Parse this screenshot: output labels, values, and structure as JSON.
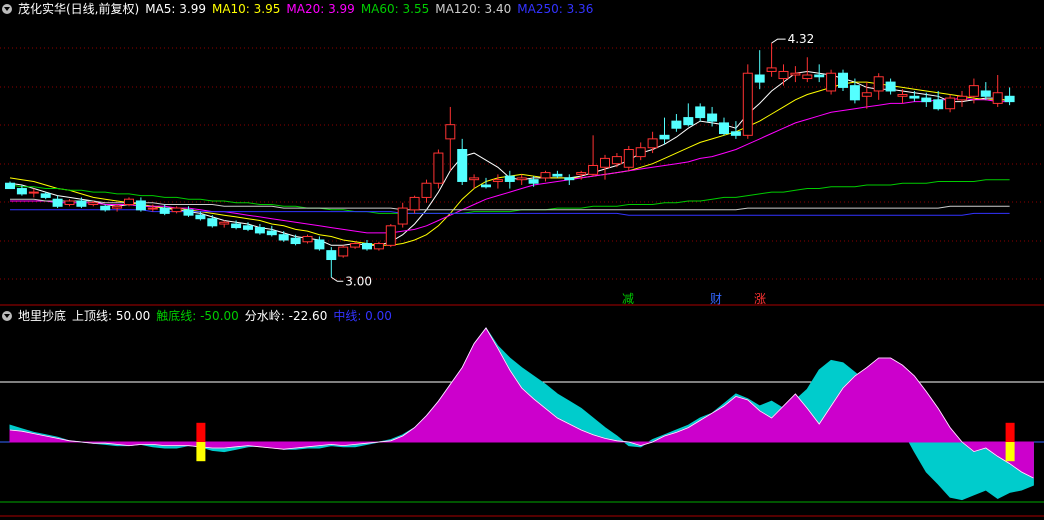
{
  "header": {
    "title": "茂化实华(日线,前复权)",
    "ma_labels": [
      {
        "text": "MA5: 3.99",
        "color": "#ffffff"
      },
      {
        "text": "MA10: 3.95",
        "color": "#ffff00"
      },
      {
        "text": "MA20: 3.99",
        "color": "#ff00ff"
      },
      {
        "text": "MA60: 3.55",
        "color": "#00cc00"
      },
      {
        "text": "MA120: 3.40",
        "color": "#cccccc"
      },
      {
        "text": "MA250: 3.36",
        "color": "#3333ff"
      }
    ]
  },
  "indicator_header": {
    "name": "地里抄底",
    "labels": [
      {
        "text": "上顶线: 50.00",
        "color": "#ffffff"
      },
      {
        "text": "触底线: -50.00",
        "color": "#00cc00"
      },
      {
        "text": "分水岭: -22.60",
        "color": "#ffffff"
      },
      {
        "text": "中线: 0.00",
        "color": "#3333ff"
      }
    ]
  },
  "annotations": {
    "high_label": "4.32",
    "low_label": "3.00",
    "markers": [
      {
        "text": "减",
        "color": "#00cc00"
      },
      {
        "text": "财",
        "color": "#3366ff"
      },
      {
        "text": "涨",
        "color": "#ff3333"
      }
    ]
  },
  "colors": {
    "up": "#ff3333",
    "down": "#54ffff",
    "bg": "#000000",
    "grid": "#8b0000"
  },
  "chart_data": [
    {
      "type": "candlestick",
      "title": "茂化实华(日线,前复权)",
      "ylim": [
        2.9,
        4.45
      ],
      "candles": [
        [
          3.53,
          3.54,
          3.5,
          3.5
        ],
        [
          3.5,
          3.52,
          3.46,
          3.47
        ],
        [
          3.48,
          3.5,
          3.45,
          3.48
        ],
        [
          3.47,
          3.48,
          3.44,
          3.45
        ],
        [
          3.44,
          3.46,
          3.39,
          3.4
        ],
        [
          3.41,
          3.44,
          3.4,
          3.43
        ],
        [
          3.43,
          3.45,
          3.39,
          3.4
        ],
        [
          3.41,
          3.43,
          3.4,
          3.42
        ],
        [
          3.4,
          3.41,
          3.37,
          3.38
        ],
        [
          3.39,
          3.41,
          3.37,
          3.4
        ],
        [
          3.41,
          3.45,
          3.4,
          3.44
        ],
        [
          3.43,
          3.45,
          3.37,
          3.38
        ],
        [
          3.39,
          3.41,
          3.37,
          3.39
        ],
        [
          3.39,
          3.41,
          3.35,
          3.36
        ],
        [
          3.37,
          3.4,
          3.36,
          3.39
        ],
        [
          3.38,
          3.4,
          3.34,
          3.35
        ],
        [
          3.35,
          3.37,
          3.32,
          3.33
        ],
        [
          3.33,
          3.35,
          3.28,
          3.29
        ],
        [
          3.3,
          3.32,
          3.28,
          3.31
        ],
        [
          3.3,
          3.32,
          3.27,
          3.28
        ],
        [
          3.29,
          3.31,
          3.26,
          3.27
        ],
        [
          3.28,
          3.3,
          3.24,
          3.25
        ],
        [
          3.26,
          3.29,
          3.23,
          3.24
        ],
        [
          3.24,
          3.26,
          3.2,
          3.21
        ],
        [
          3.22,
          3.24,
          3.18,
          3.19
        ],
        [
          3.2,
          3.24,
          3.19,
          3.23
        ],
        [
          3.21,
          3.23,
          3.15,
          3.16
        ],
        [
          3.15,
          3.17,
          3.0,
          3.1
        ],
        [
          3.12,
          3.18,
          3.11,
          3.17
        ],
        [
          3.17,
          3.2,
          3.16,
          3.19
        ],
        [
          3.19,
          3.21,
          3.15,
          3.16
        ],
        [
          3.16,
          3.2,
          3.15,
          3.19
        ],
        [
          3.18,
          3.3,
          3.17,
          3.29
        ],
        [
          3.3,
          3.42,
          3.28,
          3.39
        ],
        [
          3.38,
          3.46,
          3.36,
          3.45
        ],
        [
          3.45,
          3.55,
          3.42,
          3.53
        ],
        [
          3.53,
          3.72,
          3.5,
          3.7
        ],
        [
          3.78,
          3.96,
          3.6,
          3.86
        ],
        [
          3.72,
          3.78,
          3.52,
          3.54
        ],
        [
          3.55,
          3.58,
          3.5,
          3.56
        ],
        [
          3.52,
          3.56,
          3.5,
          3.51
        ],
        [
          3.54,
          3.58,
          3.5,
          3.55
        ],
        [
          3.57,
          3.6,
          3.5,
          3.54
        ],
        [
          3.55,
          3.58,
          3.52,
          3.56
        ],
        [
          3.55,
          3.57,
          3.51,
          3.53
        ],
        [
          3.56,
          3.6,
          3.54,
          3.59
        ],
        [
          3.58,
          3.6,
          3.56,
          3.57
        ],
        [
          3.56,
          3.58,
          3.52,
          3.55
        ],
        [
          3.58,
          3.6,
          3.55,
          3.59
        ],
        [
          3.58,
          3.8,
          3.57,
          3.63
        ],
        [
          3.62,
          3.69,
          3.55,
          3.67
        ],
        [
          3.64,
          3.7,
          3.62,
          3.68
        ],
        [
          3.62,
          3.74,
          3.6,
          3.72
        ],
        [
          3.68,
          3.76,
          3.66,
          3.73
        ],
        [
          3.73,
          3.82,
          3.7,
          3.78
        ],
        [
          3.8,
          3.9,
          3.75,
          3.78
        ],
        [
          3.88,
          3.92,
          3.82,
          3.84
        ],
        [
          3.9,
          3.98,
          3.85,
          3.86
        ],
        [
          3.96,
          3.98,
          3.88,
          3.9
        ],
        [
          3.92,
          3.96,
          3.85,
          3.88
        ],
        [
          3.87,
          3.9,
          3.8,
          3.81
        ],
        [
          3.82,
          3.88,
          3.78,
          3.8
        ],
        [
          3.8,
          4.2,
          3.78,
          4.15
        ],
        [
          4.14,
          4.28,
          4.06,
          4.1
        ],
        [
          4.16,
          4.32,
          4.13,
          4.18
        ],
        [
          4.12,
          4.2,
          4.08,
          4.16
        ],
        [
          4.14,
          4.19,
          4.1,
          4.15
        ],
        [
          4.12,
          4.24,
          4.1,
          4.14
        ],
        [
          4.14,
          4.2,
          4.1,
          4.13
        ],
        [
          4.05,
          4.17,
          4.03,
          4.15
        ],
        [
          4.15,
          4.17,
          4.05,
          4.07
        ],
        [
          4.08,
          4.12,
          3.98,
          4.0
        ],
        [
          4.02,
          4.1,
          3.95,
          4.04
        ],
        [
          4.05,
          4.15,
          4.0,
          4.13
        ],
        [
          4.1,
          4.12,
          4.03,
          4.05
        ],
        [
          4.02,
          4.06,
          3.98,
          4.03
        ],
        [
          4.02,
          4.05,
          3.99,
          4.01
        ],
        [
          4.01,
          4.04,
          3.96,
          3.99
        ],
        [
          4.0,
          4.05,
          3.94,
          3.95
        ],
        [
          3.95,
          4.03,
          3.93,
          4.01
        ],
        [
          4.0,
          4.05,
          3.96,
          4.02
        ],
        [
          4.02,
          4.12,
          3.98,
          4.08
        ],
        [
          4.05,
          4.1,
          4.0,
          4.02
        ],
        [
          3.98,
          4.14,
          3.96,
          4.04
        ],
        [
          4.02,
          4.07,
          3.97,
          3.99
        ]
      ],
      "ma": {
        "MA5": [
          3.53,
          3.52,
          3.5,
          3.48,
          3.46,
          3.45,
          3.44,
          3.43,
          3.41,
          3.4,
          3.41,
          3.4,
          3.4,
          3.39,
          3.38,
          3.37,
          3.36,
          3.34,
          3.32,
          3.31,
          3.3,
          3.28,
          3.27,
          3.25,
          3.23,
          3.22,
          3.21,
          3.18,
          3.18,
          3.19,
          3.18,
          3.18,
          3.2,
          3.24,
          3.3,
          3.38,
          3.48,
          3.6,
          3.68,
          3.7,
          3.66,
          3.62,
          3.56,
          3.55,
          3.56,
          3.56,
          3.56,
          3.56,
          3.57,
          3.59,
          3.61,
          3.63,
          3.66,
          3.7,
          3.72,
          3.75,
          3.79,
          3.84,
          3.88,
          3.87,
          3.86,
          3.84,
          3.92,
          3.98,
          4.05,
          4.1,
          4.15,
          4.16,
          4.15,
          4.14,
          4.12,
          4.1,
          4.07,
          4.06,
          4.06,
          4.05,
          4.04,
          4.03,
          4.02,
          3.99,
          3.99,
          4.0,
          4.01,
          4.01,
          3.99
        ],
        "MA10": [
          3.56,
          3.55,
          3.54,
          3.52,
          3.5,
          3.49,
          3.47,
          3.45,
          3.44,
          3.43,
          3.42,
          3.41,
          3.4,
          3.39,
          3.39,
          3.38,
          3.37,
          3.36,
          3.35,
          3.34,
          3.33,
          3.32,
          3.3,
          3.29,
          3.27,
          3.26,
          3.24,
          3.23,
          3.21,
          3.2,
          3.19,
          3.18,
          3.18,
          3.19,
          3.21,
          3.24,
          3.29,
          3.36,
          3.44,
          3.5,
          3.54,
          3.56,
          3.57,
          3.58,
          3.57,
          3.56,
          3.56,
          3.56,
          3.56,
          3.57,
          3.58,
          3.59,
          3.6,
          3.62,
          3.64,
          3.67,
          3.7,
          3.73,
          3.76,
          3.78,
          3.8,
          3.82,
          3.85,
          3.88,
          3.92,
          3.96,
          4.0,
          4.03,
          4.05,
          4.07,
          4.09,
          4.1,
          4.1,
          4.09,
          4.08,
          4.07,
          4.06,
          4.05,
          4.04,
          4.03,
          4.02,
          4.01,
          4.0,
          4.0,
          4.0
        ],
        "MA20": [
          3.43,
          3.43,
          3.43,
          3.43,
          3.42,
          3.42,
          3.42,
          3.42,
          3.41,
          3.41,
          3.41,
          3.4,
          3.4,
          3.4,
          3.39,
          3.39,
          3.38,
          3.37,
          3.37,
          3.36,
          3.35,
          3.34,
          3.33,
          3.32,
          3.31,
          3.3,
          3.29,
          3.28,
          3.27,
          3.26,
          3.25,
          3.25,
          3.25,
          3.26,
          3.27,
          3.29,
          3.32,
          3.35,
          3.38,
          3.41,
          3.44,
          3.46,
          3.48,
          3.5,
          3.52,
          3.53,
          3.54,
          3.55,
          3.56,
          3.57,
          3.58,
          3.59,
          3.6,
          3.61,
          3.62,
          3.63,
          3.64,
          3.65,
          3.67,
          3.68,
          3.7,
          3.72,
          3.75,
          3.78,
          3.81,
          3.84,
          3.87,
          3.89,
          3.91,
          3.93,
          3.94,
          3.95,
          3.96,
          3.97,
          3.98,
          3.98,
          3.99,
          3.99,
          4.0,
          4.0,
          4.01,
          4.0,
          4.0,
          3.99,
          3.99
        ],
        "MA60": [
          3.52,
          3.51,
          3.51,
          3.5,
          3.5,
          3.49,
          3.49,
          3.48,
          3.48,
          3.47,
          3.47,
          3.46,
          3.46,
          3.45,
          3.45,
          3.44,
          3.44,
          3.43,
          3.43,
          3.42,
          3.42,
          3.41,
          3.41,
          3.4,
          3.4,
          3.39,
          3.39,
          3.38,
          3.38,
          3.37,
          3.37,
          3.36,
          3.36,
          3.36,
          3.36,
          3.36,
          3.36,
          3.36,
          3.36,
          3.37,
          3.37,
          3.37,
          3.37,
          3.38,
          3.38,
          3.38,
          3.39,
          3.39,
          3.39,
          3.4,
          3.4,
          3.4,
          3.41,
          3.41,
          3.41,
          3.42,
          3.42,
          3.43,
          3.43,
          3.44,
          3.45,
          3.45,
          3.46,
          3.47,
          3.48,
          3.48,
          3.49,
          3.5,
          3.5,
          3.51,
          3.51,
          3.51,
          3.52,
          3.52,
          3.52,
          3.53,
          3.53,
          3.53,
          3.54,
          3.54,
          3.54,
          3.54,
          3.55,
          3.55,
          3.55
        ],
        "MA120": [
          3.44,
          3.44,
          3.44,
          3.43,
          3.43,
          3.43,
          3.43,
          3.43,
          3.42,
          3.42,
          3.42,
          3.42,
          3.42,
          3.41,
          3.41,
          3.41,
          3.41,
          3.41,
          3.4,
          3.4,
          3.4,
          3.4,
          3.4,
          3.39,
          3.39,
          3.39,
          3.39,
          3.39,
          3.39,
          3.39,
          3.39,
          3.39,
          3.39,
          3.38,
          3.38,
          3.38,
          3.38,
          3.38,
          3.38,
          3.38,
          3.38,
          3.38,
          3.38,
          3.38,
          3.38,
          3.38,
          3.38,
          3.38,
          3.38,
          3.38,
          3.38,
          3.38,
          3.38,
          3.38,
          3.38,
          3.38,
          3.38,
          3.38,
          3.38,
          3.38,
          3.38,
          3.38,
          3.39,
          3.39,
          3.39,
          3.39,
          3.39,
          3.39,
          3.39,
          3.39,
          3.39,
          3.39,
          3.39,
          3.39,
          3.39,
          3.39,
          3.39,
          3.39,
          3.39,
          3.4,
          3.4,
          3.4,
          3.4,
          3.4,
          3.4
        ],
        "MA250": [
          3.38,
          3.38,
          3.38,
          3.38,
          3.38,
          3.38,
          3.38,
          3.38,
          3.38,
          3.38,
          3.38,
          3.38,
          3.37,
          3.37,
          3.37,
          3.37,
          3.37,
          3.37,
          3.37,
          3.37,
          3.37,
          3.37,
          3.37,
          3.37,
          3.37,
          3.37,
          3.37,
          3.37,
          3.37,
          3.37,
          3.37,
          3.37,
          3.37,
          3.36,
          3.36,
          3.36,
          3.36,
          3.36,
          3.36,
          3.36,
          3.36,
          3.36,
          3.36,
          3.36,
          3.36,
          3.36,
          3.36,
          3.36,
          3.36,
          3.36,
          3.36,
          3.36,
          3.35,
          3.35,
          3.35,
          3.35,
          3.35,
          3.35,
          3.35,
          3.35,
          3.35,
          3.35,
          3.35,
          3.35,
          3.35,
          3.35,
          3.35,
          3.35,
          3.35,
          3.35,
          3.35,
          3.35,
          3.35,
          3.35,
          3.35,
          3.35,
          3.35,
          3.35,
          3.35,
          3.35,
          3.35,
          3.36,
          3.36,
          3.36,
          3.36
        ]
      }
    },
    {
      "type": "area",
      "title": "地里抄底",
      "ylim": [
        -60,
        100
      ],
      "reference_lines": {
        "上顶线": 50,
        "触底线": -50,
        "分水岭": -22.6,
        "中线": 0
      },
      "magenta": [
        10,
        9,
        7,
        5,
        3,
        1,
        0,
        -1,
        -1,
        -2,
        -3,
        -2,
        -2,
        -3,
        -3,
        -3,
        -4,
        -5,
        -5,
        -4,
        -3,
        -4,
        -5,
        -6,
        -5,
        -4,
        -3,
        -2,
        -3,
        -2,
        -1,
        0,
        1,
        5,
        12,
        22,
        34,
        48,
        62,
        82,
        95,
        78,
        60,
        45,
        36,
        28,
        20,
        15,
        10,
        6,
        3,
        1,
        0,
        -3,
        0,
        5,
        8,
        12,
        18,
        24,
        30,
        38,
        35,
        26,
        20,
        30,
        40,
        28,
        15,
        30,
        45,
        55,
        62,
        70,
        70,
        64,
        55,
        42,
        28,
        12,
        0,
        -8,
        -5,
        -12,
        -18,
        -25,
        -30
      ],
      "cyan": [
        14,
        11,
        8,
        6,
        4,
        1,
        0,
        -1,
        -2,
        -3,
        -3,
        -2,
        -4,
        -5,
        -5,
        -3,
        -4,
        -7,
        -8,
        -6,
        -4,
        -3,
        -4,
        -6,
        -6,
        -5,
        -5,
        -3,
        -4,
        -4,
        -2,
        0,
        2,
        6,
        12,
        22,
        34,
        48,
        62,
        82,
        95,
        80,
        70,
        62,
        55,
        48,
        40,
        34,
        28,
        20,
        12,
        5,
        -3,
        -4,
        2,
        6,
        10,
        14,
        20,
        24,
        32,
        40,
        36,
        30,
        34,
        28,
        35,
        44,
        60,
        68,
        66,
        58,
        50,
        40,
        28,
        10,
        -8,
        -25,
        -35,
        -46,
        -48,
        -44,
        -40,
        -47,
        -42,
        -40,
        -36
      ],
      "signals": [
        {
          "day": 16,
          "value": "抄底"
        },
        {
          "day": 84,
          "value": "抄底"
        }
      ]
    }
  ]
}
